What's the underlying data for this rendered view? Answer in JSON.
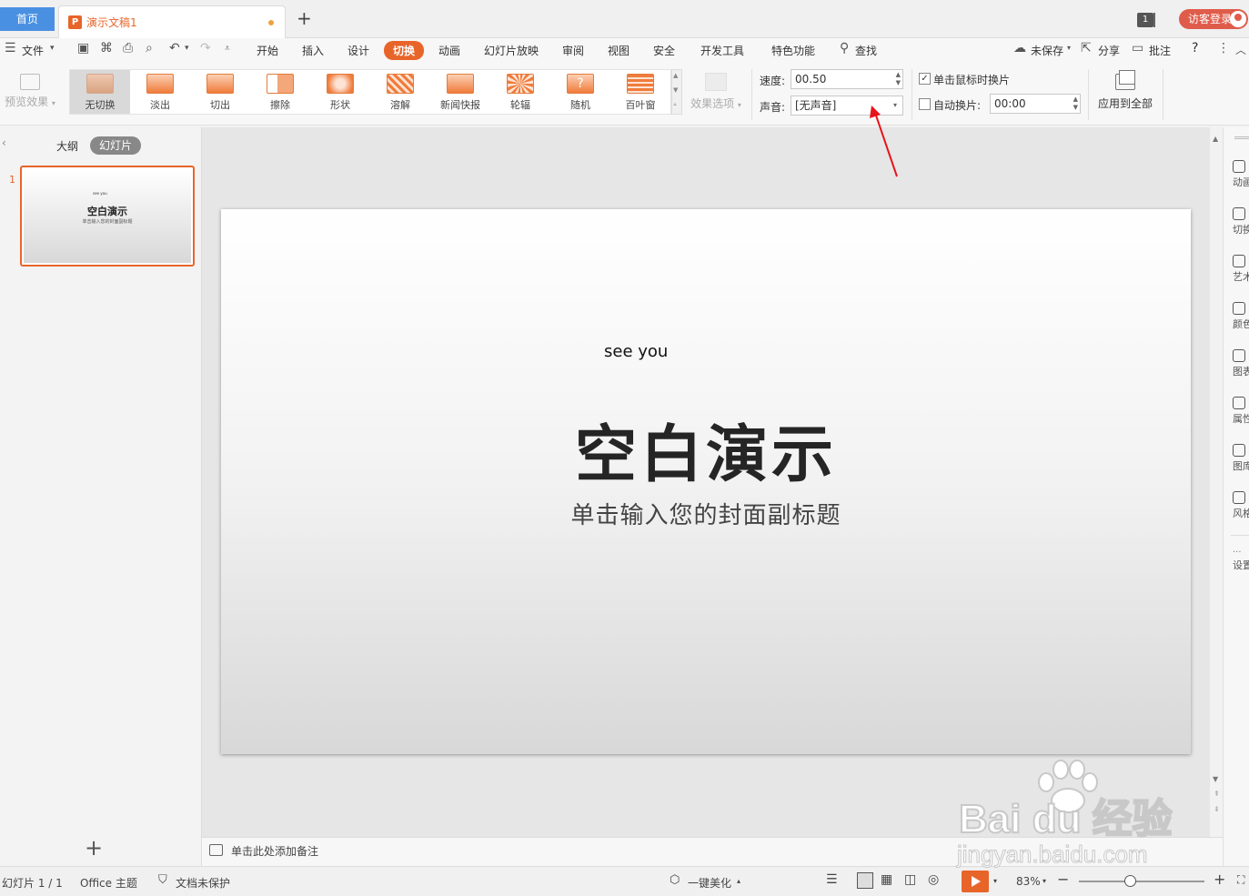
{
  "titlebar": {
    "home_tab": "首页",
    "doc_tab": "演示文稿1",
    "new_tab": "+",
    "window_badge": "1",
    "login": "访客登录"
  },
  "menubar": {
    "file": "文件",
    "tabs": [
      "开始",
      "插入",
      "设计",
      "切换",
      "动画",
      "幻灯片放映",
      "审阅",
      "视图",
      "安全",
      "开发工具",
      "特色功能"
    ],
    "active_tab": "切换",
    "search": "查找",
    "unsaved": "未保存",
    "share": "分享",
    "comment": "批注",
    "help": "?"
  },
  "ribbon": {
    "preview": "预览效果",
    "effects": [
      "无切换",
      "淡出",
      "切出",
      "擦除",
      "形状",
      "溶解",
      "新闻快报",
      "轮辐",
      "随机",
      "百叶窗"
    ],
    "selected_effect": "无切换",
    "effect_options": "效果选项",
    "speed_label": "速度:",
    "speed_value": "00.50",
    "sound_label": "声音:",
    "sound_value": "[无声音]",
    "on_click_label": "单击鼠标时换片",
    "on_click_checked": true,
    "auto_label": "自动换片:",
    "auto_checked": false,
    "auto_value": "00:00",
    "apply_all": "应用到全部"
  },
  "left_panel": {
    "tab_outline": "大纲",
    "tab_slides": "幻灯片",
    "slide_number": "1",
    "add": "+"
  },
  "slide": {
    "small_text": "see you",
    "title": "空白演示",
    "subtitle": "单击输入您的封面副标题"
  },
  "right_panel": {
    "items": [
      "动画",
      "切换",
      "艺术",
      "颜色",
      "图表",
      "属性",
      "图库",
      "风格",
      "设置"
    ]
  },
  "notes": {
    "placeholder": "单击此处添加备注"
  },
  "statusbar": {
    "slide_count": "幻灯片 1 / 1",
    "theme": "Office 主题",
    "protection": "文档未保护",
    "beautify": "一键美化",
    "zoom": "83%"
  },
  "watermark": {
    "brand": "Bai du 经验",
    "url": "jingyan.baidu.com"
  },
  "colors": {
    "accent": "#e8652a",
    "home_tab": "#4a90e2",
    "login": "#e05c4a",
    "annotation_arrow": "#e8141b"
  }
}
